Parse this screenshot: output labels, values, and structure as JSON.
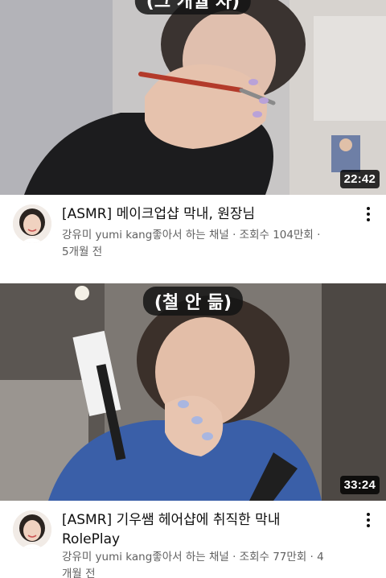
{
  "videos": [
    {
      "title": "[ASMR] 메이크업샵 막내, 원장님",
      "channel_line": "강유미 yumi kang좋아서 하는 채널 · 조회수 104만회 ·",
      "age_line": "5개월 전",
      "duration": "22:42",
      "caption": "(그 개월 차)"
    },
    {
      "title_line1": "[ASMR] 기우쌤 헤어샵에 취직한 막내",
      "title_line2": "RolePlay",
      "channel_line": "강유미 yumi kang좋아서 하는 채널 · 조회수 77만회 · 4",
      "age_line": "개월 전",
      "duration": "33:24",
      "caption": "(철 안 듦)"
    }
  ],
  "icons": {
    "more": "more-vert-icon",
    "avatar": "channel-avatar"
  }
}
